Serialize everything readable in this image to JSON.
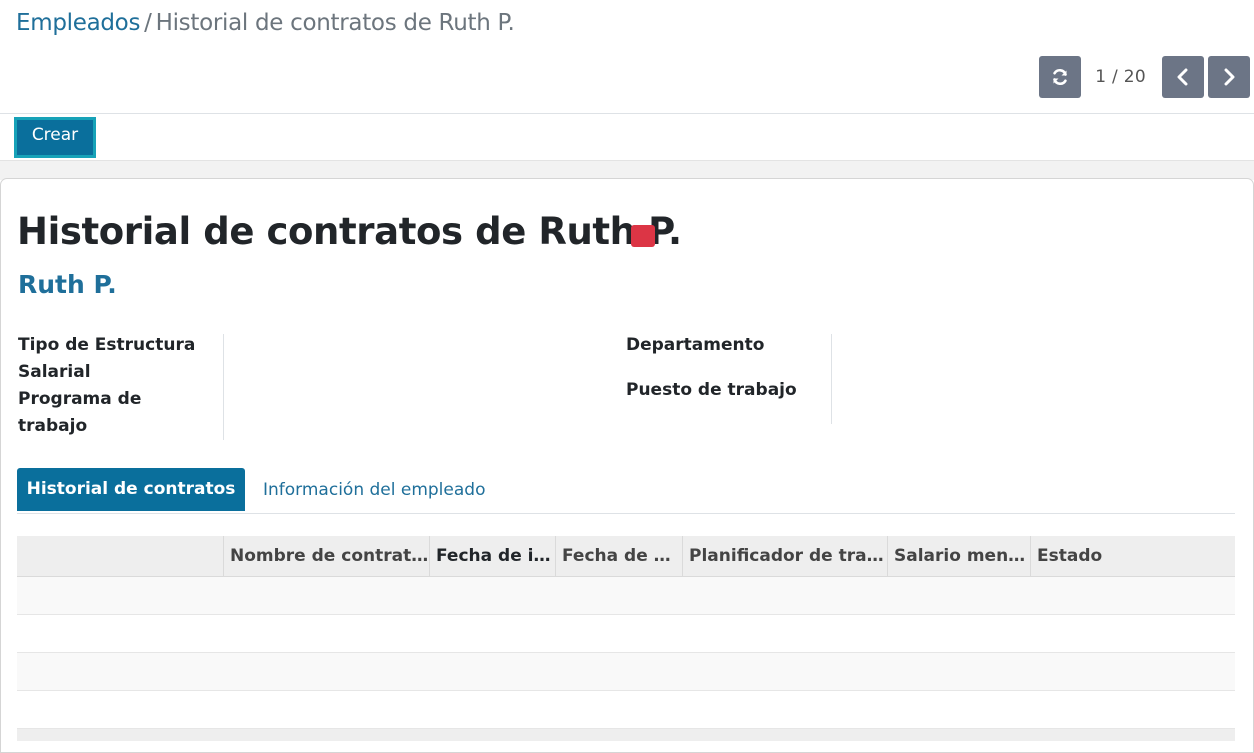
{
  "breadcrumb": {
    "parent": "Empleados",
    "separator": "/",
    "current": "Historial de contratos de Ruth P."
  },
  "pager": {
    "value": "1 / 20",
    "refresh_icon": "refresh-icon",
    "prev_icon": "chevron-left-icon",
    "next_icon": "chevron-right-icon"
  },
  "actions": {
    "create_label": "Crear"
  },
  "record": {
    "title": "Historial de contratos de Ruth P.",
    "status_color": "#dc3545",
    "employee": "Ruth P."
  },
  "fields": {
    "tipo_estructura": "Tipo de Estructura Salarial",
    "programa_trabajo": "Programa de trabajo",
    "departamento": "Departamento",
    "puesto_trabajo": "Puesto de trabajo"
  },
  "tabs": [
    {
      "label": "Historial de contratos",
      "active": true
    },
    {
      "label": "Información del empleado",
      "active": false
    }
  ],
  "table": {
    "columns": [
      "Nombre de contrat…",
      "Fecha de i…",
      "Fecha de fi…",
      "Planificador de trab…",
      "Salario mens…",
      "Estado"
    ],
    "rows": []
  },
  "colors": {
    "primary": "#0a6f9c",
    "link": "#1f6f9a",
    "focus_outline": "#17a2b8",
    "icon_button": "#6c7586"
  }
}
